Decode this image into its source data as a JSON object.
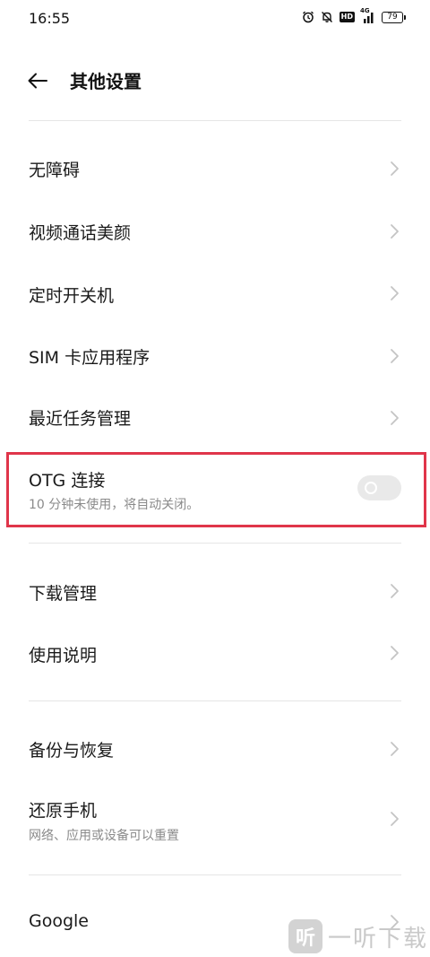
{
  "status_bar": {
    "time": "16:55",
    "network": "4G",
    "battery": "79",
    "hd": "HD",
    "icons": [
      "alarm-icon",
      "mute-icon",
      "hd-icon",
      "signal-icon",
      "battery-icon"
    ]
  },
  "header": {
    "back_icon": "arrow-left-icon",
    "title": "其他设置"
  },
  "items": [
    {
      "title": "无障碍"
    },
    {
      "title": "视频通话美颜"
    },
    {
      "title": "定时开关机"
    },
    {
      "title": "SIM 卡应用程序"
    },
    {
      "title": "最近任务管理"
    },
    {
      "title": "OTG 连接",
      "subtitle": "10 分钟未使用，将自动关闭。",
      "toggle_on": false
    },
    {
      "title": "下载管理"
    },
    {
      "title": "使用说明"
    },
    {
      "title": "备份与恢复"
    },
    {
      "title": "还原手机",
      "subtitle": "网络、应用或设备可以重置"
    },
    {
      "title": "Google"
    }
  ],
  "watermark": {
    "logo": "听",
    "text": "一听下载"
  },
  "colors": {
    "highlight": "#e0354a",
    "chevron": "#c4c4c4",
    "toggle_off": "#e9e9e9"
  }
}
